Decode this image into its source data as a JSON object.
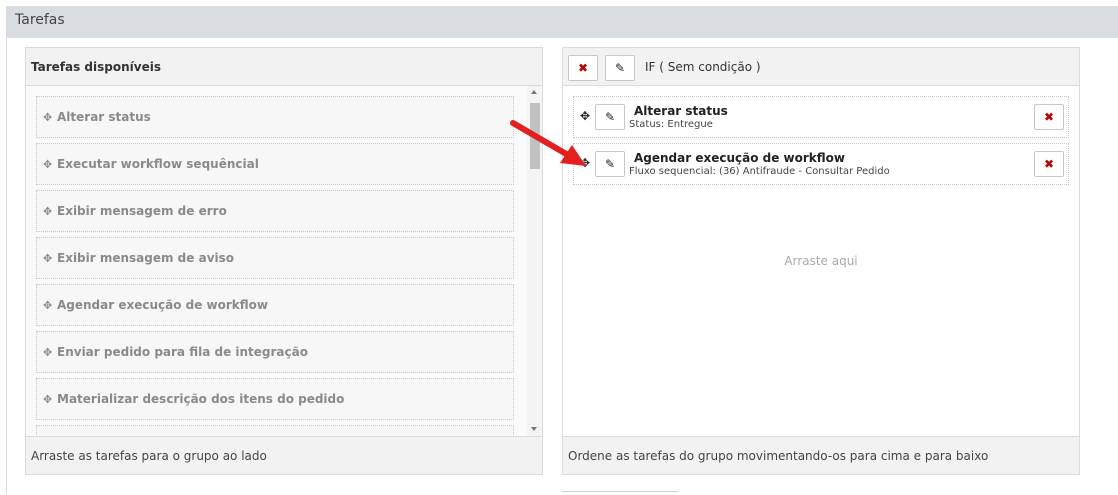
{
  "header": {
    "title": "Tarefas"
  },
  "left_panel": {
    "title": "Tarefas disponíveis",
    "items": [
      "Alterar status",
      "Executar workflow sequêncial",
      "Exibir mensagem de erro",
      "Exibir mensagem de aviso",
      "Agendar execução de workflow",
      "Enviar pedido para fila de integração",
      "Materializar descrição dos itens do pedido"
    ],
    "footer": "Arraste as tarefas para o grupo ao lado"
  },
  "right_panel": {
    "condition_label": "IF ( Sem condição )",
    "items": [
      {
        "name": "Alterar status",
        "detail": "Status: Entregue"
      },
      {
        "name": "Agendar execução de workflow",
        "detail": "Fluxo sequencial: (36) Antifraude - Consultar Pedido"
      }
    ],
    "drop_hint": "Arraste aqui",
    "footer": "Ordene as tarefas do grupo movimentando-os para cima e para baixo"
  },
  "icons": {
    "move": "move-icon",
    "edit": "pencil-icon",
    "remove": "close-icon",
    "arrow": "arrow-annotation"
  },
  "colors": {
    "header_bg": "#d9dce1",
    "remove_red": "#c00000",
    "annotation_red": "#e3201f"
  }
}
